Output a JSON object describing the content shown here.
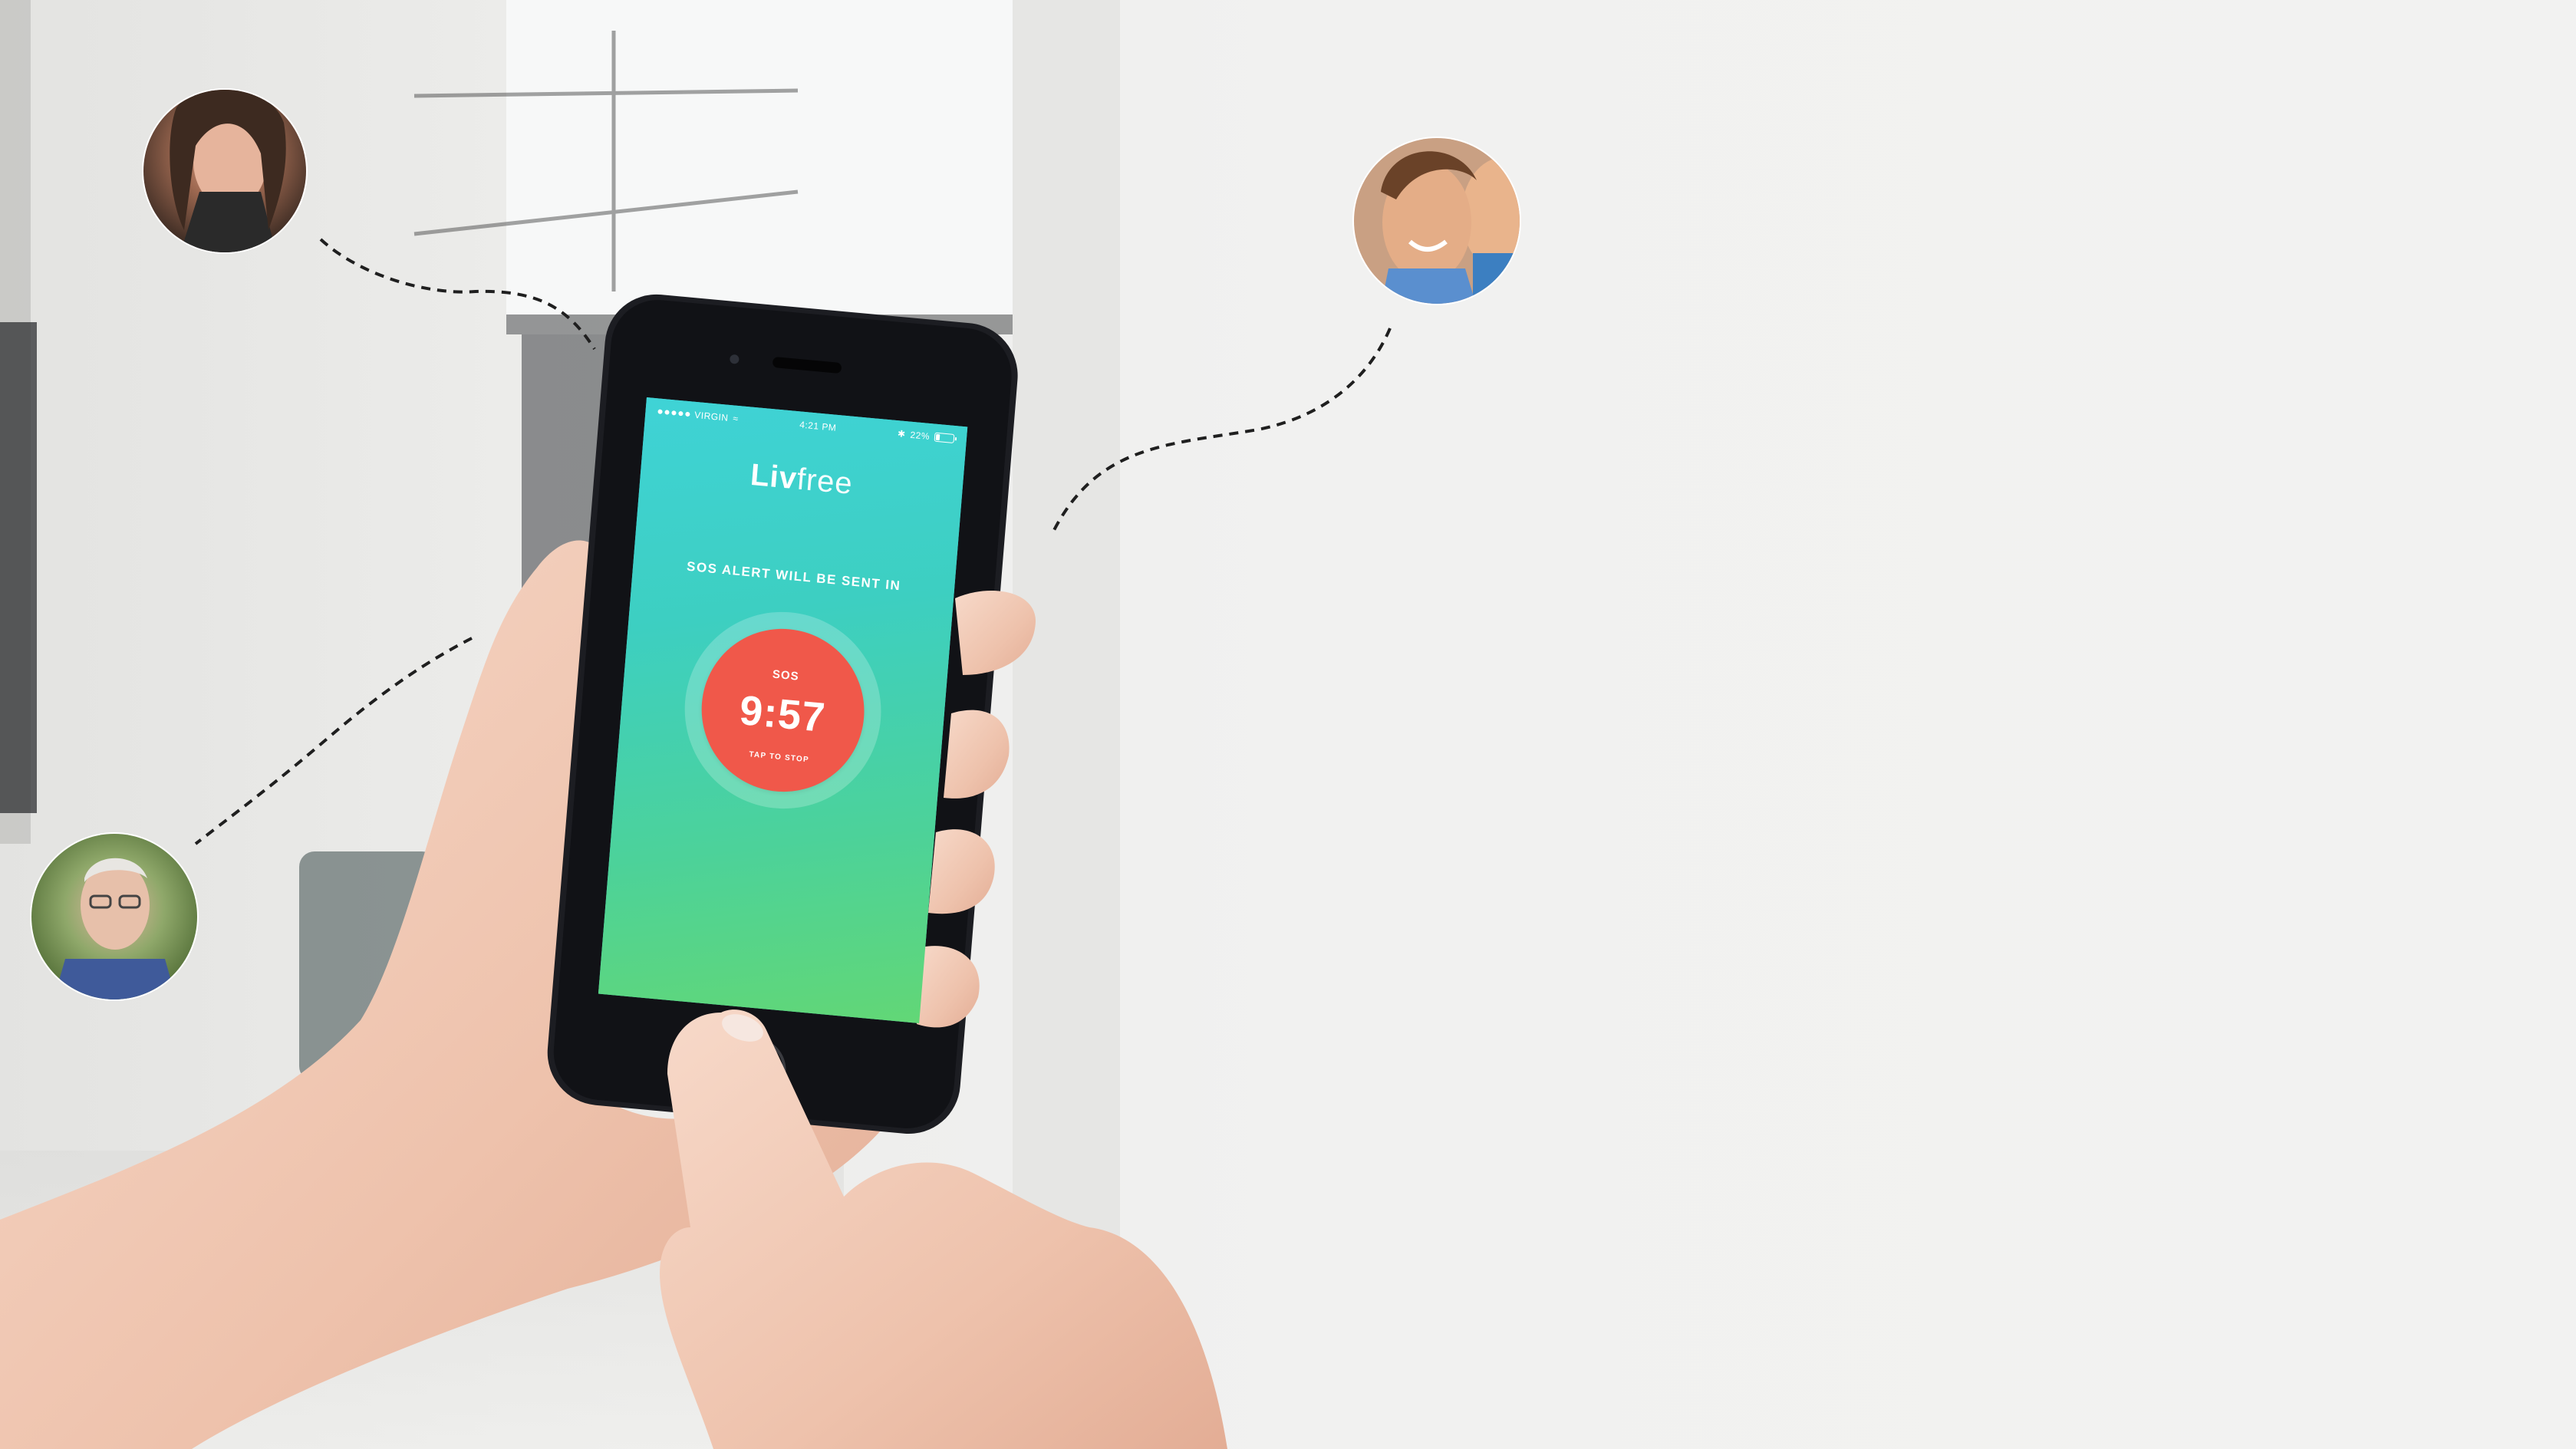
{
  "app": {
    "logo_bold": "Liv",
    "logo_light": "free"
  },
  "status_bar": {
    "carrier": "VIRGIN",
    "time": "4:21 PM",
    "battery": "22%",
    "battery_level": 0.22,
    "icons": [
      "signal-dots-icon",
      "wifi-icon",
      "bluetooth-icon",
      "battery-icon"
    ]
  },
  "sos": {
    "caption": "SOS ALERT WILL BE SENT IN",
    "label": "SOS",
    "countdown": "9:57",
    "action_hint": "TAP TO STOP"
  },
  "contacts": [
    {
      "name": "contact-woman",
      "avatar_colors": [
        "#3a2a22",
        "#d9a58b",
        "#6b4a3a"
      ]
    },
    {
      "name": "contact-man-with-child",
      "avatar_colors": [
        "#b07a4d",
        "#e8b48f",
        "#3c7fc1"
      ]
    },
    {
      "name": "contact-older-man",
      "avatar_colors": [
        "#6f8f4a",
        "#e3b9a3",
        "#3a4f8a"
      ]
    }
  ],
  "colors": {
    "screen_gradient_top": "#3fd3d6",
    "screen_gradient_bottom": "#62d776",
    "sos_red": "#f0584a",
    "phone_body": "#1c1d22"
  }
}
